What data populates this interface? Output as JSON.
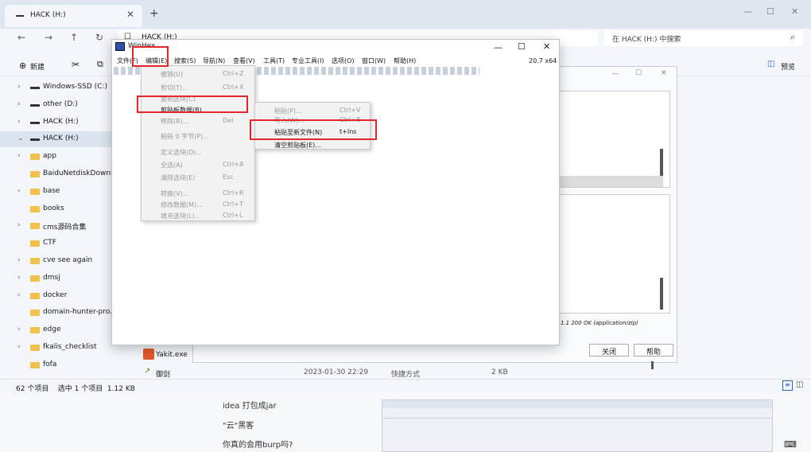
{
  "explorer": {
    "tab_title": "HACK (H:)",
    "address_text": "HACK (H:)",
    "search_placeholder": "在 HACK (H:) 中搜索",
    "new_button": "新建",
    "preview_button": "预览",
    "sidebar": [
      {
        "label": "Windows-SSD (C:)",
        "type": "drive",
        "chev": "›"
      },
      {
        "label": "other (D:)",
        "type": "drive",
        "chev": "›"
      },
      {
        "label": "HACK (H:)",
        "type": "drive",
        "chev": "›"
      },
      {
        "label": "HACK (H:)",
        "type": "drive",
        "chev": "⌄",
        "selected": true
      },
      {
        "label": "app",
        "type": "folder",
        "chev": "›"
      },
      {
        "label": "BaiduNetdiskDownload",
        "type": "folder",
        "chev": ""
      },
      {
        "label": "base",
        "type": "folder",
        "chev": "›"
      },
      {
        "label": "books",
        "type": "folder",
        "chev": ""
      },
      {
        "label": "cms源码合集",
        "type": "folder",
        "chev": "›"
      },
      {
        "label": "CTF",
        "type": "folder",
        "chev": ""
      },
      {
        "label": "cve see again",
        "type": "folder",
        "chev": "›"
      },
      {
        "label": "dmsj",
        "type": "folder",
        "chev": "›"
      },
      {
        "label": "docker",
        "type": "folder",
        "chev": "›"
      },
      {
        "label": "domain-hunter-pro.log",
        "type": "folder",
        "chev": ""
      },
      {
        "label": "edge",
        "type": "folder",
        "chev": "›"
      },
      {
        "label": "fkalis_checklist",
        "type": "folder",
        "chev": "›"
      },
      {
        "label": "fofa",
        "type": "folder",
        "chev": ""
      }
    ],
    "files": [
      {
        "name": "Yakit.exe",
        "date": "",
        "type": "",
        "size": ""
      },
      {
        "name": "御剑",
        "date": "2023-01-30 22:29",
        "type": "快捷方式",
        "size": "2 KB"
      }
    ],
    "status": "62 个项目    选中 1 个项目  1.12 KB"
  },
  "dialog": {
    "http_text": "1.1 200 OK (application/zip)",
    "close_button": "关闭",
    "help_button": "帮助"
  },
  "winhex": {
    "title": "WinHex",
    "version": "20.7 x64",
    "menubar": [
      "文件(F)",
      "编辑(E)",
      "搜索(S)",
      "导航(N)",
      "查看(V)",
      "工具(T)",
      "专业工具(I)",
      "选项(O)",
      "窗口(W)",
      "帮助(H)"
    ],
    "edit_menu": [
      {
        "label": "撤销(U)",
        "key": "Ctrl+Z",
        "disabled": true
      },
      {
        "label": "剪切(T)...",
        "key": "Ctrl+X",
        "disabled": true
      },
      {
        "label": "复制选块(C)",
        "key": "",
        "disabled": true
      },
      {
        "label": "剪贴板数据(B)",
        "key": "",
        "disabled": false
      },
      {
        "label": "移除(R)...",
        "key": "Del",
        "disabled": true
      },
      {
        "label": "粘贴 0 字节(P)...",
        "key": "",
        "disabled": true
      },
      {
        "label": "定义选块(D)...",
        "key": "",
        "disabled": true
      },
      {
        "label": "全选(A)",
        "key": "Ctrl+A",
        "disabled": true
      },
      {
        "label": "清除选块(E)",
        "key": "Esc",
        "disabled": true
      },
      {
        "label": "转换(V)...",
        "key": "Ctrl+R",
        "disabled": true
      },
      {
        "label": "修改数据(M)...",
        "key": "Ctrl+T",
        "disabled": true
      },
      {
        "label": "填充选块(L)...",
        "key": "Ctrl+L",
        "disabled": true
      }
    ],
    "clipboard_menu": [
      {
        "label": "粘贴(P)...",
        "key": "Ctrl+V",
        "disabled": true
      },
      {
        "label": "写入(W)...",
        "key": "Ctrl+B",
        "disabled": true
      },
      {
        "label": "粘贴至新文件(N)",
        "key": "t+Ins",
        "disabled": false
      },
      {
        "label": "清空剪贴板(E)...",
        "key": "",
        "disabled": false
      }
    ]
  },
  "blog": {
    "items": [
      "idea 打包成jar",
      "\"云\"黑客",
      "你真的会用burp吗?"
    ]
  },
  "colors": {
    "highlight": "#e2262b",
    "folder": "#f0c24b"
  }
}
